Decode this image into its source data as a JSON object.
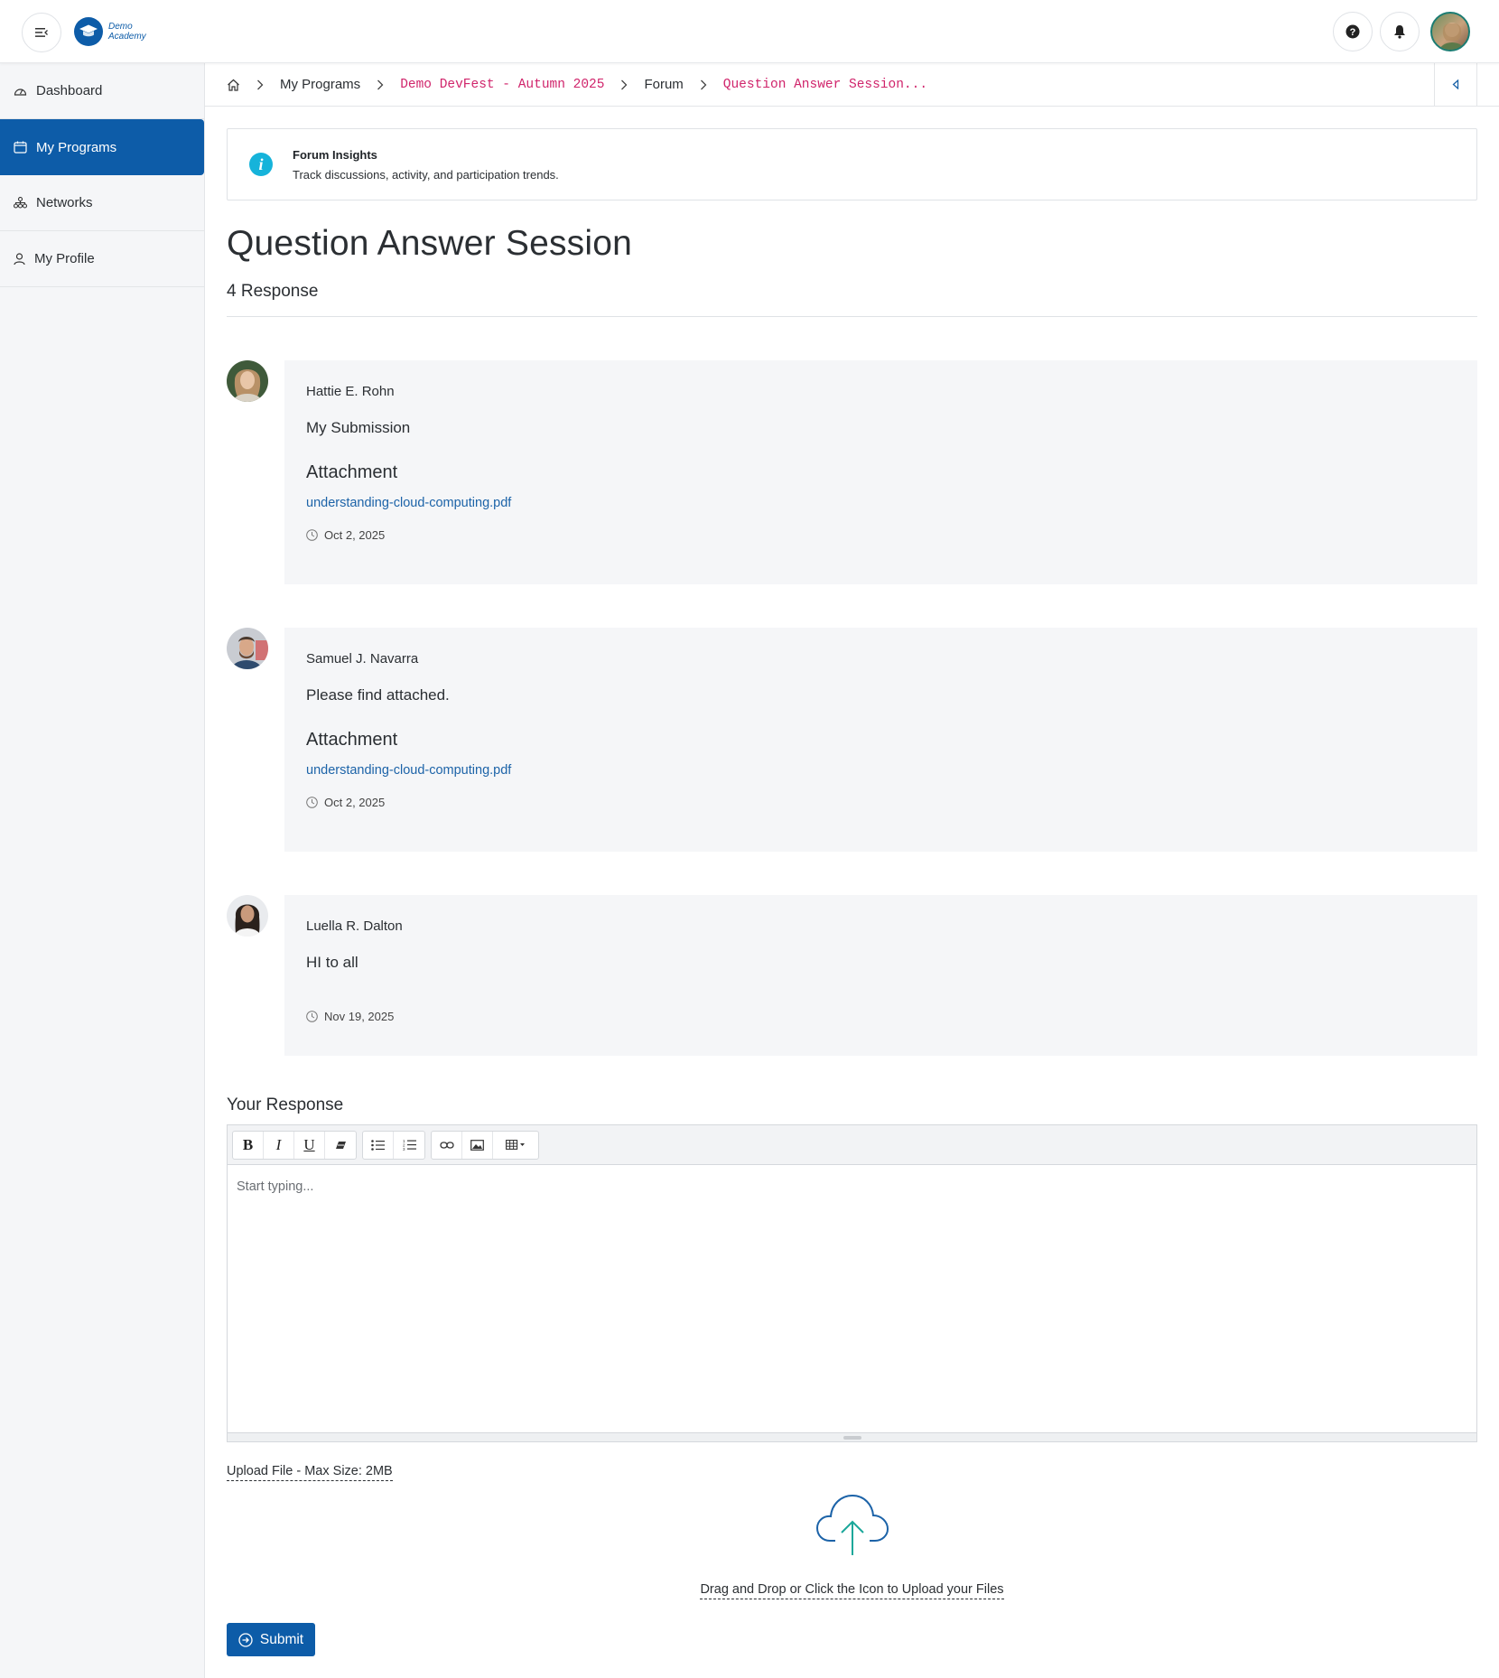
{
  "app": {
    "logo_line1": "Demo",
    "logo_line2": "Academy",
    "brand_color": "#0d5ca8",
    "accent_color": "#d0246b"
  },
  "topbar": {
    "menu_icon": "menu-icon",
    "help_icon": "help-icon",
    "bell_icon": "bell-icon"
  },
  "sidebar": {
    "items": [
      {
        "label": "Dashboard",
        "icon": "dashboard-icon",
        "active": false
      },
      {
        "label": "My Programs",
        "icon": "calendar-icon",
        "active": true
      },
      {
        "label": "Networks",
        "icon": "network-icon",
        "active": false
      },
      {
        "label": "My Profile",
        "icon": "user-icon",
        "active": false
      }
    ]
  },
  "breadcrumb": {
    "items": [
      "My Programs",
      "Demo DevFest - Autumn 2025",
      "Forum",
      "Question Answer Session..."
    ]
  },
  "info": {
    "title": "Forum Insights",
    "subtitle": "Track discussions, activity, and participation trends."
  },
  "page": {
    "title": "Question Answer Session",
    "response_count": "4 Response"
  },
  "posts": [
    {
      "author": "Hattie E. Rohn",
      "body": "My Submission",
      "attachment_title": "Attachment",
      "attachment_file": "understanding-cloud-computing.pdf",
      "date": "Oct 2, 2025"
    },
    {
      "author": "Samuel J. Navarra",
      "body": "Please find attached.",
      "attachment_title": "Attachment",
      "attachment_file": "understanding-cloud-computing.pdf",
      "date": "Oct 2, 2025"
    },
    {
      "author": "Luella R. Dalton",
      "body": "HI to all",
      "date": "Nov 19, 2025"
    }
  ],
  "response_form": {
    "heading": "Your Response",
    "placeholder": "Start typing...",
    "toolbar": [
      "bold",
      "italic",
      "underline",
      "eraser",
      "bullet-list",
      "numbered-list",
      "link",
      "image",
      "table"
    ],
    "upload_label": "Upload File - Max Size: 2MB",
    "upload_hint": "Drag and Drop or Click the Icon to Upload your Files",
    "submit_label": "Submit"
  }
}
